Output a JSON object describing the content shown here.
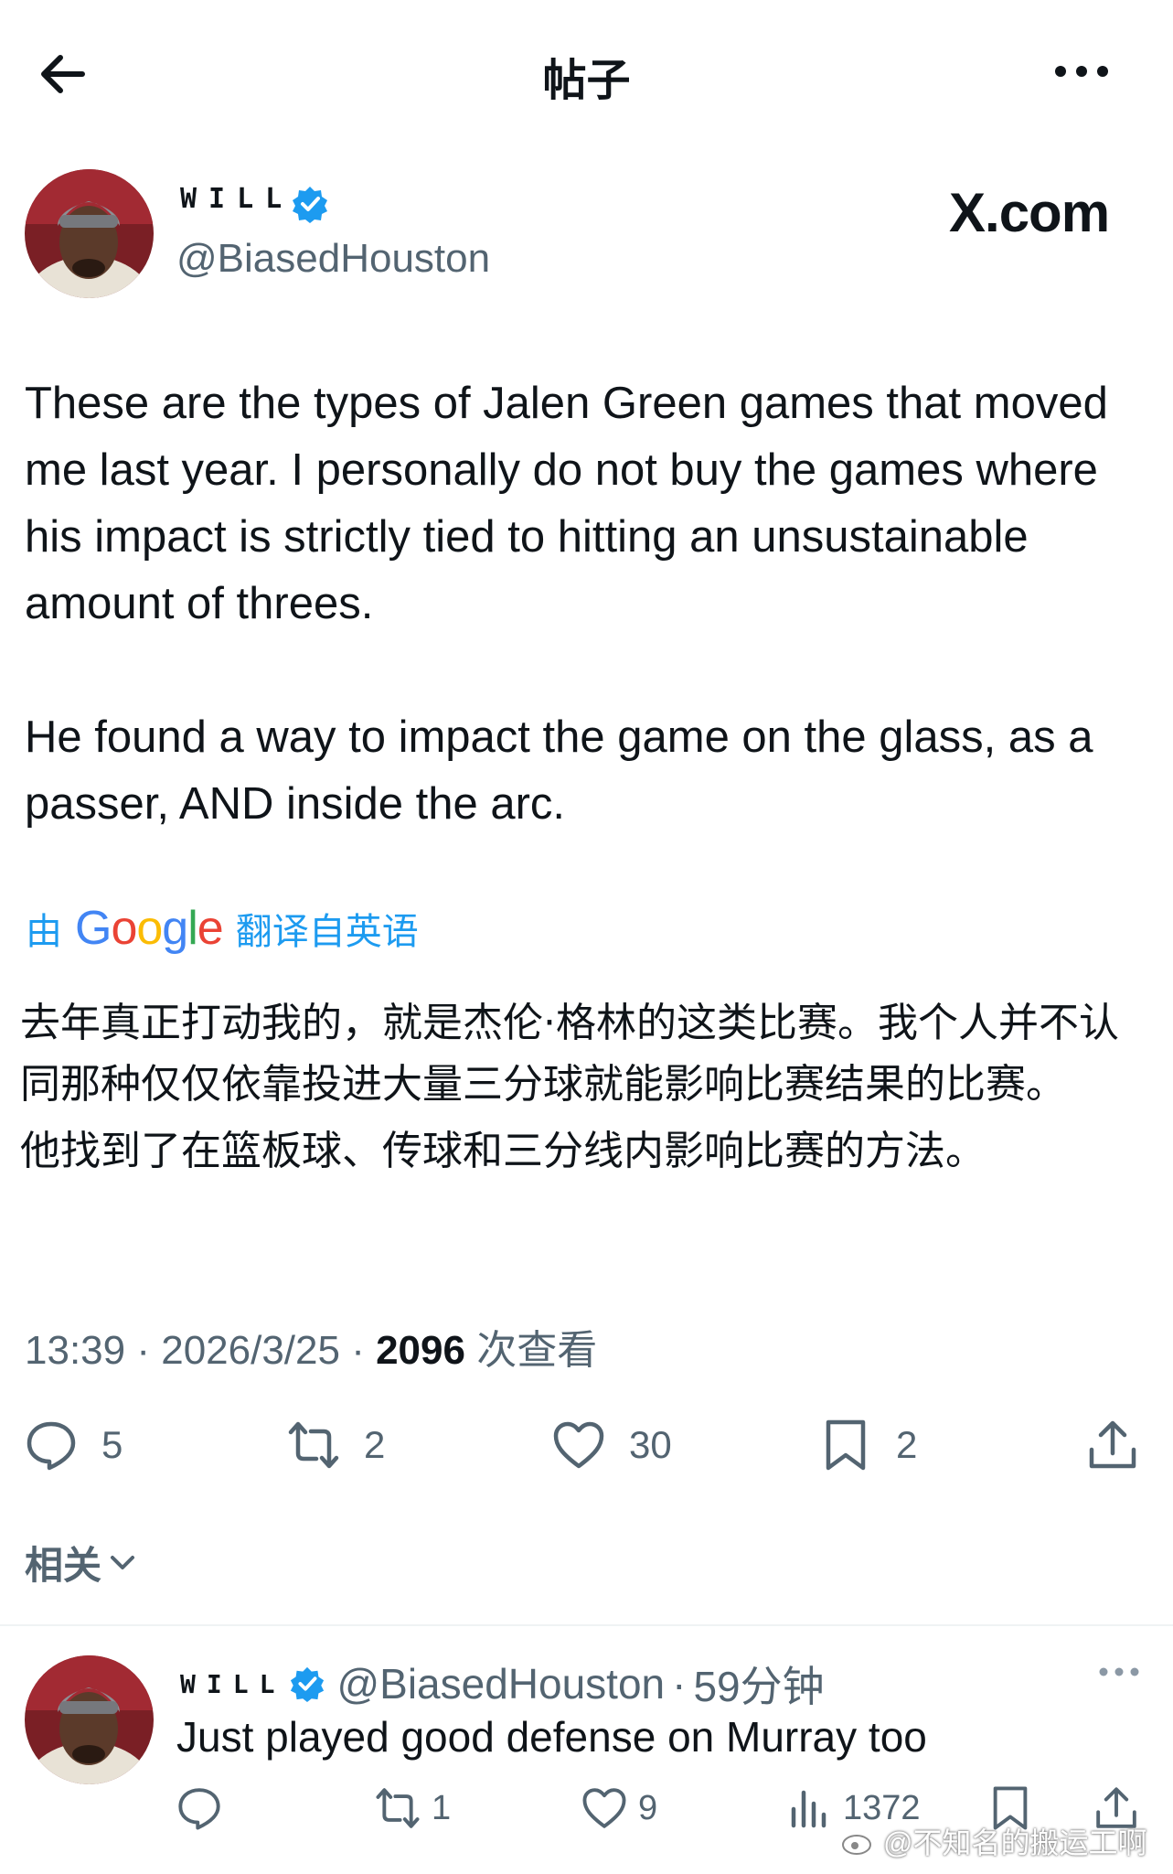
{
  "header": {
    "back_icon": "arrow-left-icon",
    "title": "帖子",
    "more_icon": "more-horizontal-icon"
  },
  "author": {
    "name": "WILL",
    "handle": "@BiasedHouston",
    "verified_icon": "verified-badge-icon",
    "verified_color": "#1d9bf0"
  },
  "watermark_logo": "X.com",
  "tweet": {
    "paragraphs": [
      "These are the types of Jalen Green games that moved me last year. I personally do not buy the games where his impact is strictly tied to hitting an unsustainable amount of threes.",
      "He found a way to impact the game on the glass, as a passer, AND inside the arc."
    ],
    "translate_prefix": "由",
    "translate_brand": "Google",
    "translate_suffix": "翻译自英语",
    "translated": [
      "去年真正打动我的，就是杰伦·格林的这类比赛。我个人并不认同那种仅仅依靠投进大量三分球就能影响比赛结果的比赛。",
      "他找到了在篮板球、传球和三分线内影响比赛的方法。"
    ],
    "time": "13:39",
    "date": "2026/3/25",
    "views": "2096",
    "views_label": "次查看"
  },
  "actions": {
    "reply_count": "5",
    "repost_count": "2",
    "like_count": "30",
    "bookmark_count": "2"
  },
  "related_label": "相关",
  "reply": {
    "name": "WILL",
    "handle": "@BiasedHouston",
    "time": "59分钟",
    "text": "Just played good defense on Murray too",
    "retweets": "1",
    "likes": "9",
    "views": "1372"
  },
  "watermark_text": "@不知名的搬运工啊",
  "colors": {
    "accent": "#1d9bf0",
    "secondary_text": "#536471",
    "primary_text": "#0f1419"
  }
}
